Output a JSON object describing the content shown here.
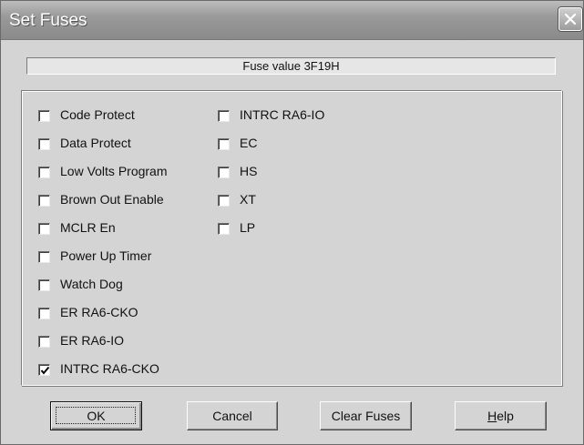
{
  "window": {
    "title": "Set Fuses"
  },
  "fuse_value": "Fuse value 3F19H",
  "options_left": [
    {
      "label": "Code Protect",
      "checked": false
    },
    {
      "label": "Data Protect",
      "checked": false
    },
    {
      "label": "Low Volts Program",
      "checked": false
    },
    {
      "label": "Brown Out Enable",
      "checked": false
    },
    {
      "label": "MCLR En",
      "checked": false
    },
    {
      "label": "Power Up Timer",
      "checked": false
    },
    {
      "label": "Watch Dog",
      "checked": false
    },
    {
      "label": "ER RA6-CKO",
      "checked": false
    },
    {
      "label": "ER RA6-IO",
      "checked": false
    },
    {
      "label": "INTRC RA6-CKO",
      "checked": true
    }
  ],
  "options_right": [
    {
      "label": "INTRC RA6-IO",
      "checked": false
    },
    {
      "label": "EC",
      "checked": false
    },
    {
      "label": "HS",
      "checked": false
    },
    {
      "label": "XT",
      "checked": false
    },
    {
      "label": "LP",
      "checked": false
    }
  ],
  "buttons": {
    "ok": "OK",
    "cancel": "Cancel",
    "clear": "Clear Fuses",
    "help_first": "H",
    "help_rest": "elp"
  }
}
